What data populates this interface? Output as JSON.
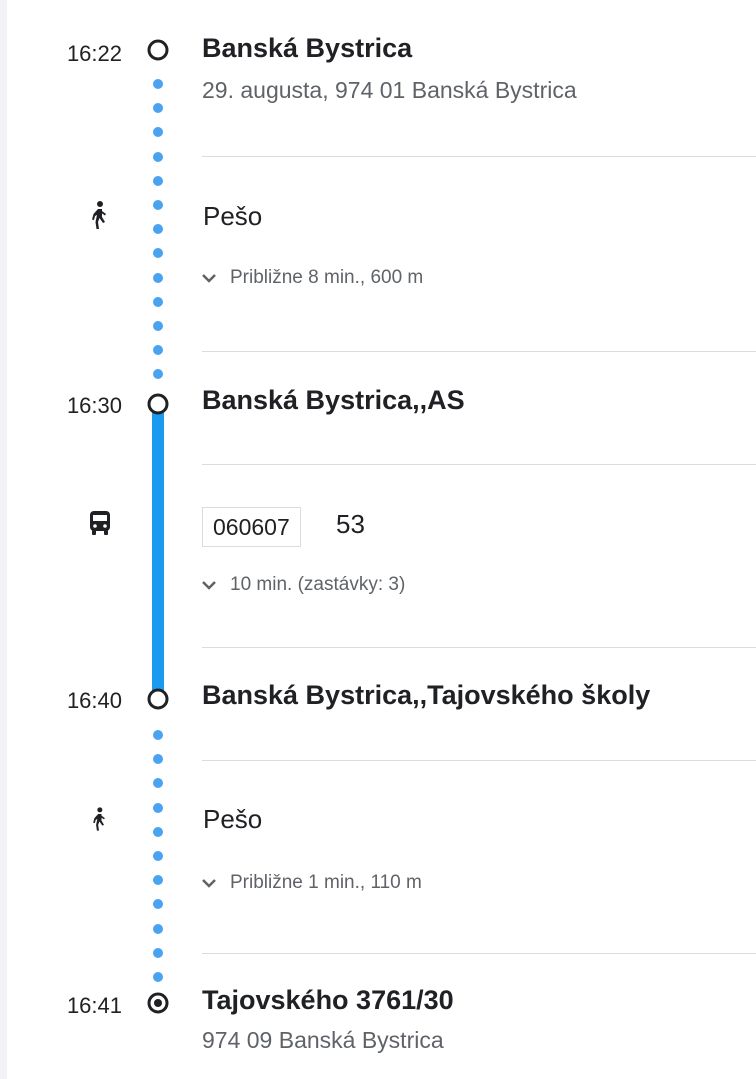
{
  "stops": [
    {
      "time": "16:22",
      "title": "Banská Bystrica",
      "address": "29. augusta, 974 01 Banská Bystrica"
    },
    {
      "time": "16:30",
      "title": "Banská Bystrica,,AS"
    },
    {
      "time": "16:40",
      "title": "Banská Bystrica,,Tajovského školy"
    },
    {
      "time": "16:41",
      "title": "Tajovského 3761/30",
      "address": "974 09 Banská Bystrica"
    }
  ],
  "segments": [
    {
      "mode": "walk",
      "icon": "walk-icon",
      "label": "Pešo",
      "detail": "Približne 8 min., 600 m"
    },
    {
      "mode": "bus",
      "icon": "bus-icon",
      "route_code": "060607",
      "route_number": "53",
      "detail": "10 min. (zastávky: 3)"
    },
    {
      "mode": "walk",
      "icon": "walk-icon",
      "label": "Pešo",
      "detail": "Približne 1 min., 110 m"
    }
  ],
  "colors": {
    "walk_dots": "#4aa3f0",
    "bus_line": "#1a9bf0",
    "secondary_text": "#5f6368"
  }
}
